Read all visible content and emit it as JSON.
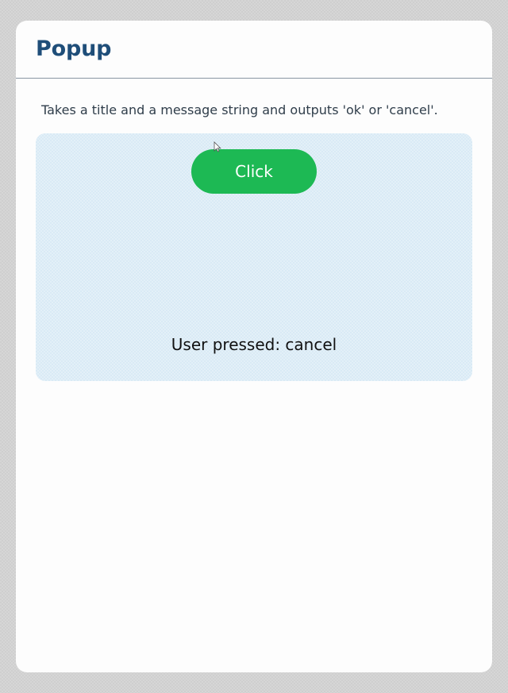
{
  "header": {
    "title": "Popup"
  },
  "main": {
    "description": "Takes a title and a message string and outputs 'ok' or 'cancel'.",
    "button_label": "Click",
    "result_text": "User pressed: cancel"
  },
  "colors": {
    "title": "#1f4e79",
    "button": "#1db954",
    "demo_area": "#e3f0f8"
  },
  "icons": {
    "cursor": "mouse-pointer-icon"
  }
}
